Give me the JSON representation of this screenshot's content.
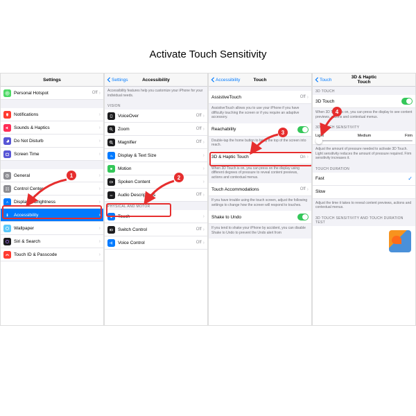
{
  "title": "Activate Touch Sensitivity",
  "steps": [
    "1",
    "2",
    "3",
    "4"
  ],
  "p1": {
    "header": "Settings",
    "items": [
      {
        "label": "Personal Hotspot",
        "val": "Off"
      },
      {
        "label": "Notifications"
      },
      {
        "label": "Sounds & Haptics"
      },
      {
        "label": "Do Not Disturb"
      },
      {
        "label": "Screen Time"
      },
      {
        "label": "General"
      },
      {
        "label": "Control Center"
      },
      {
        "label": "Display & Brightness"
      },
      {
        "label": "Accessibility",
        "highlight": true
      },
      {
        "label": "Wallpaper"
      },
      {
        "label": "Siri & Search"
      },
      {
        "label": "Touch ID & Passcode"
      }
    ]
  },
  "p2": {
    "back": "Settings",
    "title": "Accessibility",
    "desc": "Accessibility features help you customize your iPhone for your individual needs.",
    "sec1": "VISION",
    "vision": [
      {
        "label": "VoiceOver",
        "val": "Off"
      },
      {
        "label": "Zoom",
        "val": "Off"
      },
      {
        "label": "Magnifier",
        "val": "Off"
      },
      {
        "label": "Display & Text Size"
      },
      {
        "label": "Motion"
      },
      {
        "label": "Spoken Content"
      },
      {
        "label": "Audio Descriptions",
        "val": "Off"
      }
    ],
    "sec2": "PHYSICAL AND MOTOR",
    "motor": [
      {
        "label": "Touch",
        "highlight": true
      },
      {
        "label": "Switch Control",
        "val": "Off"
      },
      {
        "label": "Voice Control",
        "val": "Off"
      }
    ]
  },
  "p3": {
    "back": "Accessibility",
    "title": "Touch",
    "assistive": {
      "label": "AssistiveTouch",
      "val": "Off"
    },
    "assistive_desc": "AssistiveTouch allows you to use your iPhone if you have difficulty touching the screen or if you require an adaptive accessory.",
    "reach": {
      "label": "Reachability"
    },
    "reach_desc": "Double-tap the home button to bring the top of the screen into reach.",
    "haptic": {
      "label": "3D & Haptic Touch",
      "val": "On",
      "highlight": true
    },
    "haptic_desc": "When 3D Touch is on, you can press on the display using different degrees of pressure to reveal content previews, actions and contextual menus.",
    "accom": {
      "label": "Touch Accommodations",
      "val": "Off"
    },
    "accom_desc": "If you have trouble using the touch screen, adjust the following settings to change how the screen will respond to touches.",
    "shake": {
      "label": "Shake to Undo"
    },
    "shake_desc": "If you tend to shake your iPhone by accident, you can disable Shake to Undo to prevent the Undo alert from"
  },
  "p4": {
    "back": "Touch",
    "title": "3D & Haptic Touch",
    "sec1": "3D TOUCH",
    "toggle": {
      "label": "3D Touch"
    },
    "toggle_desc": "When 3D Touch is on, you can press the display to see content previews, actions and contextual menus.",
    "sec2": "3D TOUCH SENSITIVITY",
    "slider": {
      "light": "Light",
      "medium": "Medium",
      "firm": "Firm"
    },
    "slider_desc": "Adjust the amount of pressure needed to activate 3D Touch. Light sensitivity reduces the amount of pressure required. Firm sensitivity increases it.",
    "sec3": "TOUCH DURATION",
    "fast": "Fast",
    "slow": "Slow",
    "dur_desc": "Adjust the time it takes to reveal content previews, actions and contextual menus.",
    "sec4": "3D TOUCH SENSITIVITY AND TOUCH DURATION TEST"
  }
}
